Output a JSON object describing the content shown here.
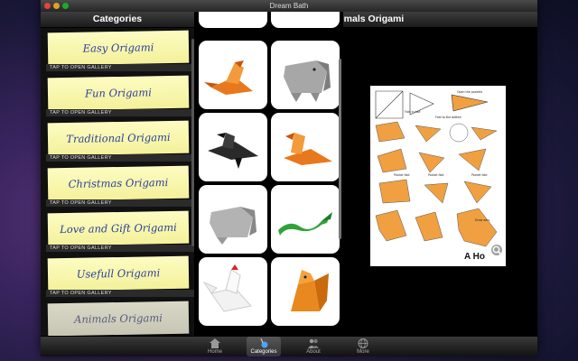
{
  "window": {
    "title": "Dream Bath"
  },
  "left_panel": {
    "title": "Categories",
    "tap_label": "TAP TO OPEN GALLERY",
    "items": [
      {
        "label": "Easy Origami"
      },
      {
        "label": "Fun Origami"
      },
      {
        "label": "Traditional Origami"
      },
      {
        "label": "Christmas Origami"
      },
      {
        "label": "Love and Gift Origami"
      },
      {
        "label": "Usefull Origami"
      },
      {
        "label": "Animals Origami"
      }
    ]
  },
  "right_panel": {
    "title": "Animals Origami"
  },
  "gallery": {
    "items": [
      {
        "icon": "orange-bird-origami"
      },
      {
        "icon": "gray-elephant-origami"
      },
      {
        "icon": "black-crow-origami"
      },
      {
        "icon": "orange-bird-origami"
      },
      {
        "icon": "gray-elephant-origami"
      },
      {
        "icon": "green-snake-origami"
      },
      {
        "icon": "white-rooster-origami"
      },
      {
        "icon": "orange-squirrel-origami"
      }
    ]
  },
  "viewer": {
    "diagram_caption": "A Ho"
  },
  "tabbar": {
    "tabs": [
      {
        "label": "Home",
        "icon": "home-icon"
      },
      {
        "label": "Categories",
        "icon": "categories-icon",
        "active": true
      },
      {
        "label": "About",
        "icon": "about-icon"
      },
      {
        "label": "More",
        "icon": "globe-icon"
      }
    ]
  },
  "colors": {
    "note_yellow": "#f3f19a",
    "note_text": "#2a3e9e",
    "window_bg": "#000000"
  }
}
